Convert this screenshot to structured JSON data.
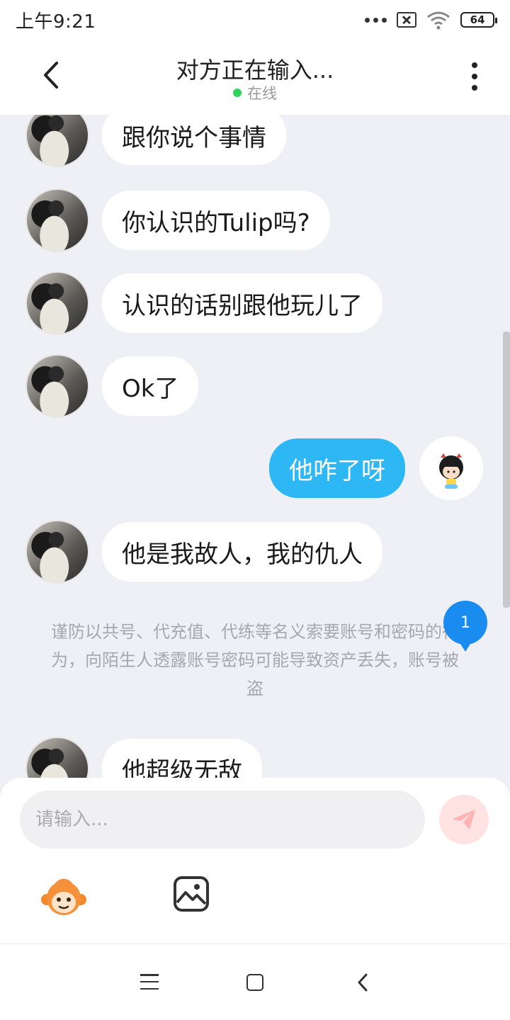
{
  "status_bar": {
    "time": "上午9:21",
    "battery": "64"
  },
  "header": {
    "title": "对方正在输入...",
    "status": "在线",
    "status_color": "#2bd45a"
  },
  "messages": [
    {
      "side": "in",
      "text": "跟你说个事情"
    },
    {
      "side": "in",
      "text": "你认识的Tulip吗?"
    },
    {
      "side": "in",
      "text": "认识的话别跟他玩儿了"
    },
    {
      "side": "in",
      "text": "Ok了"
    },
    {
      "side": "out",
      "text": "他咋了呀"
    },
    {
      "side": "in",
      "text": "他是我故人，我的仇人"
    },
    {
      "side": "in",
      "text": "他超级无敌"
    }
  ],
  "notice": "谨防以共号、代充值、代练等名义索要账号和密码的行为，向陌生人透露账号密码可能导致资产丢失，账号被盗",
  "unread_count": "1",
  "input": {
    "placeholder": "请输入..."
  },
  "icons": {
    "emoji": "monkey-emoji-icon",
    "image": "image-icon",
    "send": "paper-plane-icon"
  },
  "colors": {
    "outgoing_bubble": "#2db7f5",
    "badge": "#1a8cf0",
    "chat_background": "#eef0f6"
  }
}
